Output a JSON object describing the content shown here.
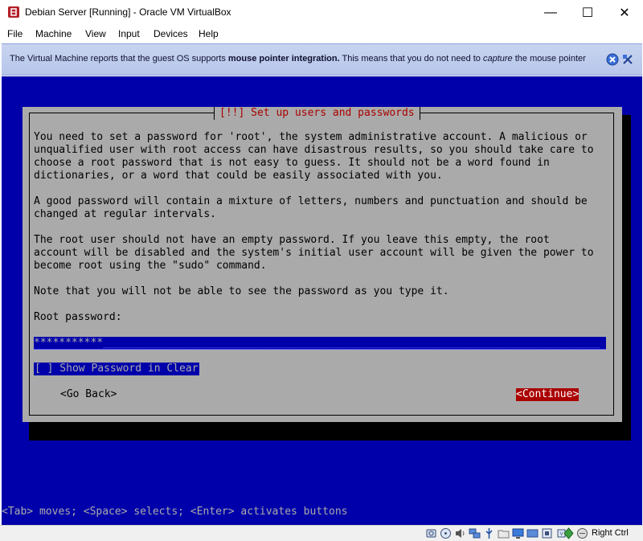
{
  "window": {
    "title": "Debian Server [Running] - Oracle VM VirtualBox",
    "minimize_glyph": "—",
    "maximize_glyph": "☐",
    "close_glyph": "✕"
  },
  "menu": [
    "File",
    "Machine",
    "View",
    "Input",
    "Devices",
    "Help"
  ],
  "banner": {
    "text_prefix": "The Virtual Machine reports that the guest OS supports ",
    "text_bold": "mouse pointer integration.",
    "text_mid": " This means that you do not need to ",
    "text_italic": "capture",
    "text_suffix": " the mouse pointer"
  },
  "installer": {
    "dialog_title": "[!!] Set up users and passwords",
    "paragraph1": "You need to set a password for 'root', the system administrative account. A malicious or\nunqualified user with root access can have disastrous results, so you should take care to\nchoose a root password that is not easy to guess. It should not be a word found in\ndictionaries, or a word that could be easily associated with you.",
    "paragraph2": "A good password will contain a mixture of letters, numbers and punctuation and should be\nchanged at regular intervals.",
    "paragraph3": "The root user should not have an empty password. If you leave this empty, the root\naccount will be disabled and the system's initial user account will be given the power to\nbecome root using the \"sudo\" command.",
    "paragraph4": "Note that you will not be able to see the password as you type it.",
    "password_label": "Root password:",
    "password_value": "***********",
    "password_fill": "_______________________________________________________________________________",
    "show_password_checkbox": "[ ] Show Password in Clear",
    "go_back_button": "<Go Back>",
    "continue_button": "<Continue>",
    "help_line": "<Tab> moves; <Space> selects; <Enter> activates buttons"
  },
  "statusbar": {
    "host_key": "Right Ctrl",
    "icons": [
      "hard-disk-icon",
      "optical-drive-icon",
      "audio-icon",
      "network-icon",
      "usb-icon",
      "shared-folders-icon",
      "display-icon",
      "video-capture-icon",
      "recording-icon",
      "cpu-icon",
      "mouse-integration-icon",
      "keyboard-capture-icon",
      "host-key-arrow-icon"
    ]
  },
  "colors": {
    "vm_background": "#0000aa",
    "dialog_background": "#aaaaaa",
    "dialog_title": "#aa0000",
    "continue_button": "#aa0000"
  }
}
